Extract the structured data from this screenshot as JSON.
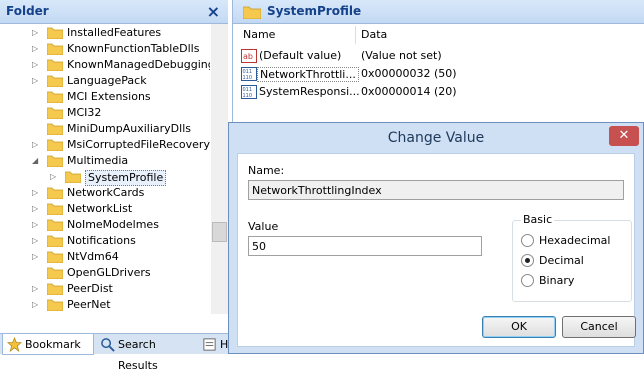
{
  "folder_pane": {
    "title": "Folder",
    "close_glyph": "×",
    "tree": [
      {
        "label": "InstalledFeatures",
        "arrow": "▷"
      },
      {
        "label": "KnownFunctionTableDlls",
        "arrow": "▷"
      },
      {
        "label": "KnownManagedDebugging",
        "arrow": "▷"
      },
      {
        "label": "LanguagePack",
        "arrow": "▷"
      },
      {
        "label": "MCI Extensions",
        "arrow": ""
      },
      {
        "label": "MCI32",
        "arrow": ""
      },
      {
        "label": "MiniDumpAuxiliaryDlls",
        "arrow": ""
      },
      {
        "label": "MsiCorruptedFileRecovery",
        "arrow": "▷"
      },
      {
        "label": "Multimedia",
        "arrow": "◢"
      },
      {
        "label": "SystemProfile",
        "arrow": "▷",
        "child": true,
        "selected": true
      },
      {
        "label": "NetworkCards",
        "arrow": "▷"
      },
      {
        "label": "NetworkList",
        "arrow": "▷"
      },
      {
        "label": "NoImeModelmes",
        "arrow": "▷"
      },
      {
        "label": "Notifications",
        "arrow": "▷"
      },
      {
        "label": "NtVdm64",
        "arrow": "▷"
      },
      {
        "label": "OpenGLDrivers",
        "arrow": ""
      },
      {
        "label": "PeerDist",
        "arrow": "▷"
      },
      {
        "label": "PeerNet",
        "arrow": "▷"
      }
    ],
    "bottom_tabs": {
      "bookmark": "Bookmark",
      "search_results": "Search Results",
      "third": "H"
    }
  },
  "value_pane": {
    "title": "SystemProfile",
    "columns": {
      "name": "Name",
      "data": "Data"
    },
    "rows": [
      {
        "icon": "string-value-icon",
        "name": "(Default value)",
        "data": "(Value not set)"
      },
      {
        "icon": "dword-value-icon",
        "name": "NetworkThrottli...",
        "data": "0x00000032 (50)"
      },
      {
        "icon": "dword-value-icon",
        "name": "SystemResponsi...",
        "data": "0x00000014 (20)"
      }
    ]
  },
  "dialog": {
    "title": "Change Value",
    "close_glyph": "✕",
    "name_label": "Name:",
    "name_value": "NetworkThrottlingIndex",
    "value_label": "Value",
    "value_value": "50",
    "base_label": "Basic",
    "radios": [
      {
        "label": "Hexadecimal",
        "checked": false
      },
      {
        "label": "Decimal",
        "checked": true
      },
      {
        "label": "Binary",
        "checked": false
      }
    ],
    "ok_label": "OK",
    "cancel_label": "Cancel"
  },
  "colors": {
    "accent": "#15428b",
    "folder": "#f5c94e",
    "close": "#c75050"
  }
}
